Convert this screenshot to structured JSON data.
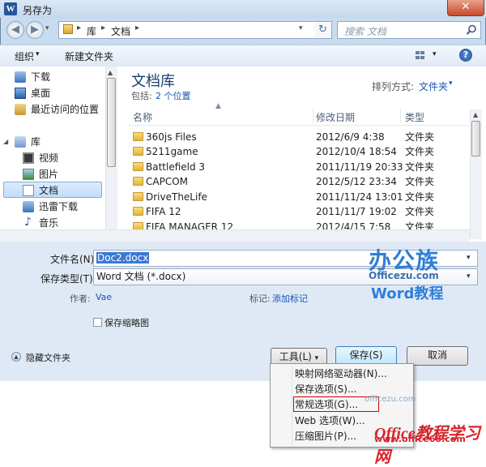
{
  "window": {
    "title": "另存为",
    "app_icon": "W",
    "close": "✕"
  },
  "nav": {
    "back": "◀",
    "forward": "▶",
    "dropdown": "▾",
    "breadcrumb": [
      "库",
      "文档"
    ],
    "refresh": "↻",
    "search_placeholder": "搜索 文档"
  },
  "toolbar": {
    "organize": "组织",
    "new_folder": "新建文件夹"
  },
  "sidebar": {
    "items": [
      {
        "label": "下载",
        "icon": "download-folder-icon"
      },
      {
        "label": "桌面",
        "icon": "desktop-icon"
      },
      {
        "label": "最近访问的位置",
        "icon": "recent-places-icon"
      },
      {
        "label": "库",
        "icon": "libraries-icon"
      },
      {
        "label": "视频",
        "icon": "video-icon"
      },
      {
        "label": "图片",
        "icon": "pictures-icon"
      },
      {
        "label": "文档",
        "icon": "documents-icon"
      },
      {
        "label": "迅雷下载",
        "icon": "thunder-download-icon"
      },
      {
        "label": "音乐",
        "icon": "music-icon"
      }
    ]
  },
  "library": {
    "title": "文档库",
    "includes_label": "包括:",
    "locations_link": "2 个位置",
    "arrange_label": "排列方式:",
    "arrange_value": "文件夹"
  },
  "columns": {
    "name": "名称",
    "date": "修改日期",
    "type": "类型"
  },
  "files": [
    {
      "name": "360js Files",
      "date": "2012/6/9 4:38",
      "type": "文件夹"
    },
    {
      "name": "5211game",
      "date": "2012/10/4 18:54",
      "type": "文件夹"
    },
    {
      "name": "Battlefield 3",
      "date": "2011/11/19 20:33",
      "type": "文件夹"
    },
    {
      "name": "CAPCOM",
      "date": "2012/5/12 23:34",
      "type": "文件夹"
    },
    {
      "name": "DriveTheLife",
      "date": "2011/11/24 13:01",
      "type": "文件夹"
    },
    {
      "name": "FIFA 12",
      "date": "2011/11/7 19:02",
      "type": "文件夹"
    },
    {
      "name": "FIFA MANAGER 12",
      "date": "2012/4/15 7:58",
      "type": "文件夹"
    }
  ],
  "form": {
    "filename_label": "文件名(N):",
    "filename_value": "Doc2.docx",
    "savetype_label": "保存类型(T):",
    "savetype_value": "Word 文档 (*.docx)",
    "author_label": "作者:",
    "author_value": "Vae",
    "tags_label": "标记:",
    "tags_value": "添加标记",
    "thumbnail_label": "保存缩略图"
  },
  "footer": {
    "hide_folders": "隐藏文件夹",
    "tools": "工具(L)",
    "save": "保存(S)",
    "cancel": "取消"
  },
  "tools_menu": [
    "映射网络驱动器(N)...",
    "保存选项(S)...",
    "常规选项(G)...",
    "Web 选项(W)...",
    "压缩图片(P)..."
  ],
  "watermarks": {
    "brand_cn": "办公族",
    "brand_url": "Officezu.com",
    "brand_course": "Word教程",
    "site2": "Office教程学习网",
    "site2_url": "www.office68.com",
    "faint_url": "officezu.com"
  }
}
